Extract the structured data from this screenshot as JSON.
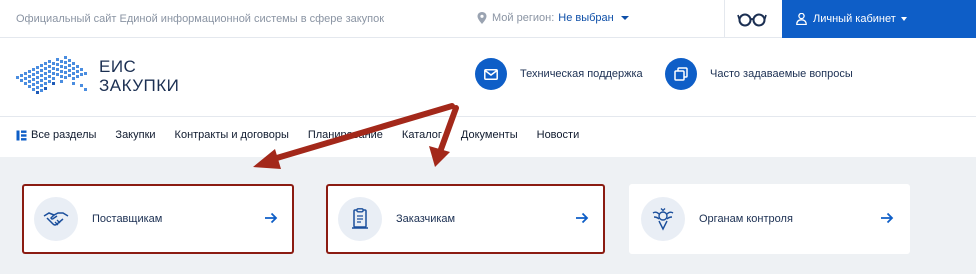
{
  "topbar": {
    "site_caption": "Официальный сайт Единой информационной системы в сфере закупок",
    "region_label": "Мой регион:",
    "region_value": "Не выбран",
    "cabinet_label": "Личный кабинет"
  },
  "logo": {
    "line1": "ЕИС",
    "line2": "ЗАКУПКИ"
  },
  "header_links": [
    {
      "label": "Техническая поддержка",
      "icon": "mail-icon"
    },
    {
      "label": "Часто задаваемые вопросы",
      "icon": "faq-icon"
    }
  ],
  "nav": {
    "all_sections": "Все разделы",
    "items": [
      "Закупки",
      "Контракты и договоры",
      "Планирование",
      "Каталог",
      "Документы",
      "Новости"
    ]
  },
  "cards": [
    {
      "label": "Поставщикам",
      "icon": "handshake-icon",
      "highlighted": true
    },
    {
      "label": "Заказчикам",
      "icon": "document-icon",
      "highlighted": true
    },
    {
      "label": "Органам контроля",
      "icon": "emblem-icon",
      "highlighted": false
    }
  ],
  "colors": {
    "brand_blue": "#0e5ec7",
    "annotation_red": "#8b1c12",
    "card_bg": "#eef1f4"
  }
}
